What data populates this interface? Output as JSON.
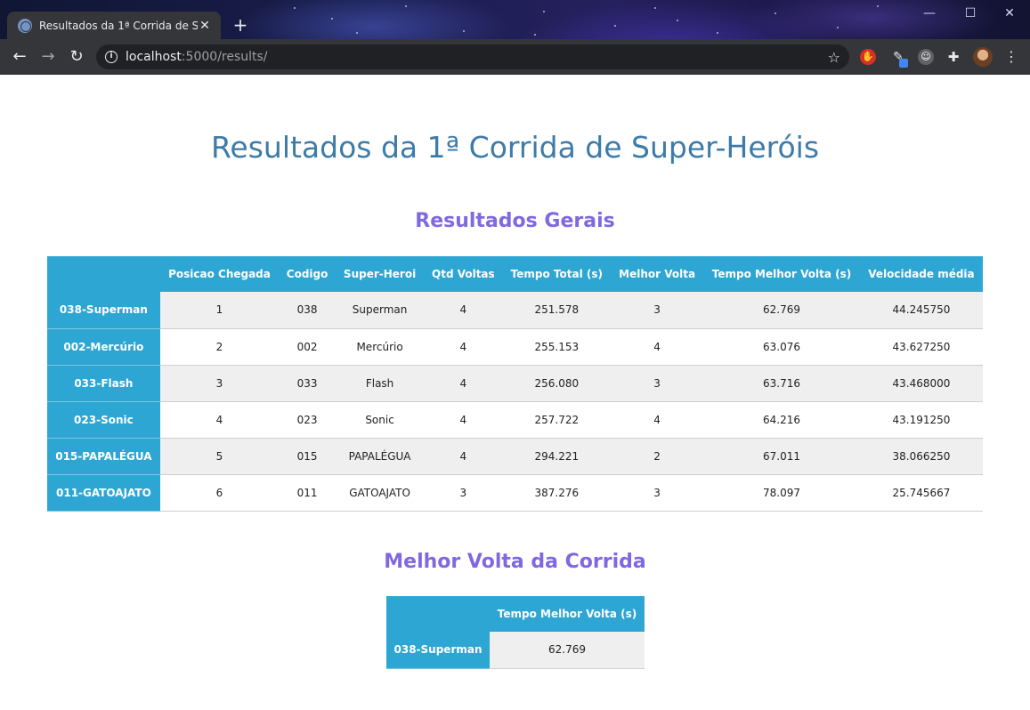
{
  "browser": {
    "tab_title": "Resultados da 1ª Corrida de Super-Heróis",
    "tab_close": "✕",
    "new_tab": "+",
    "url_host": "localhost",
    "url_rest": ":5000/results/",
    "window_controls": {
      "minimize": "—",
      "maximize": "☐",
      "close": "✕"
    },
    "nav": {
      "back": "←",
      "forward": "→",
      "reload": "↻"
    },
    "icons": [
      "info-icon",
      "bookmark-star-icon",
      "extension-icons",
      "puzzle-icon",
      "profile-avatar",
      "menu-icon"
    ]
  },
  "page": {
    "title": "Resultados da 1ª Corrida de Super-Heróis",
    "general_section_title": "Resultados Gerais",
    "best_lap_section_title": "Melhor Volta da Corrida"
  },
  "results_table": {
    "columns": [
      "",
      "Posicao Chegada",
      "Codigo",
      "Super-Heroi",
      "Qtd Voltas",
      "Tempo Total (s)",
      "Melhor Volta",
      "Tempo Melhor Volta (s)",
      "Velocidade média"
    ],
    "rows": [
      {
        "label": "038-Superman",
        "cells": [
          "1",
          "038",
          "Superman",
          "4",
          "251.578",
          "3",
          "62.769",
          "44.245750"
        ]
      },
      {
        "label": "002-Mercúrio",
        "cells": [
          "2",
          "002",
          "Mercúrio",
          "4",
          "255.153",
          "4",
          "63.076",
          "43.627250"
        ]
      },
      {
        "label": "033-Flash",
        "cells": [
          "3",
          "033",
          "Flash",
          "4",
          "256.080",
          "3",
          "63.716",
          "43.468000"
        ]
      },
      {
        "label": "023-Sonic",
        "cells": [
          "4",
          "023",
          "Sonic",
          "4",
          "257.722",
          "4",
          "64.216",
          "43.191250"
        ]
      },
      {
        "label": "015-PAPALÉGUA",
        "cells": [
          "5",
          "015",
          "PAPALÉGUA",
          "4",
          "294.221",
          "2",
          "67.011",
          "38.066250"
        ]
      },
      {
        "label": "011-GATOAJATO",
        "cells": [
          "6",
          "011",
          "GATOAJATO",
          "3",
          "387.276",
          "3",
          "78.097",
          "25.745667"
        ]
      }
    ]
  },
  "best_lap_table": {
    "columns": [
      "",
      "Tempo Melhor Volta (s)"
    ],
    "rows": [
      {
        "label": "038-Superman",
        "cells": [
          "62.769"
        ]
      }
    ]
  },
  "colors": {
    "table_header": "#2ea6d3",
    "page_title": "#3d7ba8",
    "section_title": "#8068e0",
    "row_alt": "#efefef"
  }
}
